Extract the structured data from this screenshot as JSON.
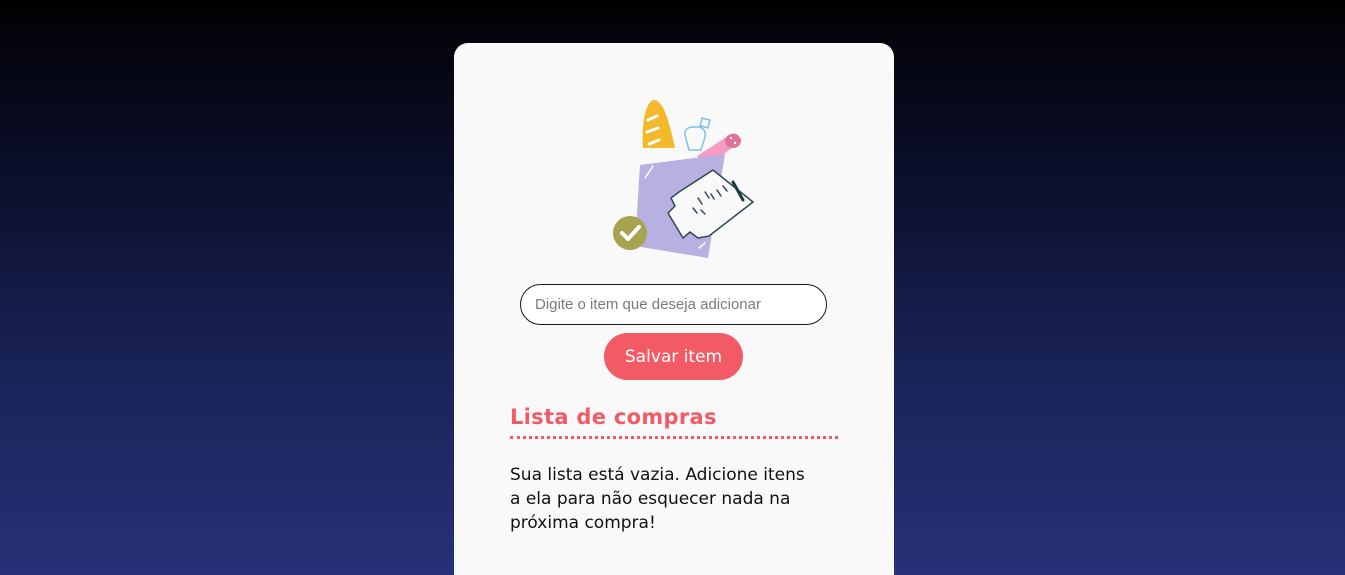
{
  "form": {
    "input_placeholder": "Digite o item que deseja adicionar",
    "input_value": "",
    "save_label": "Salvar item"
  },
  "list": {
    "title": "Lista de compras",
    "empty_message": "Sua lista está vazia. Adicione itens a ela para não esquecer nada na próxima compra!"
  },
  "colors": {
    "accent": "#f25a66",
    "card_background": "#f9f9f9",
    "bag": "#b8b0e0",
    "bread": "#f2b92a",
    "check": "#a8a34e"
  },
  "icons": {
    "illustration": "grocery-bag-icon"
  }
}
